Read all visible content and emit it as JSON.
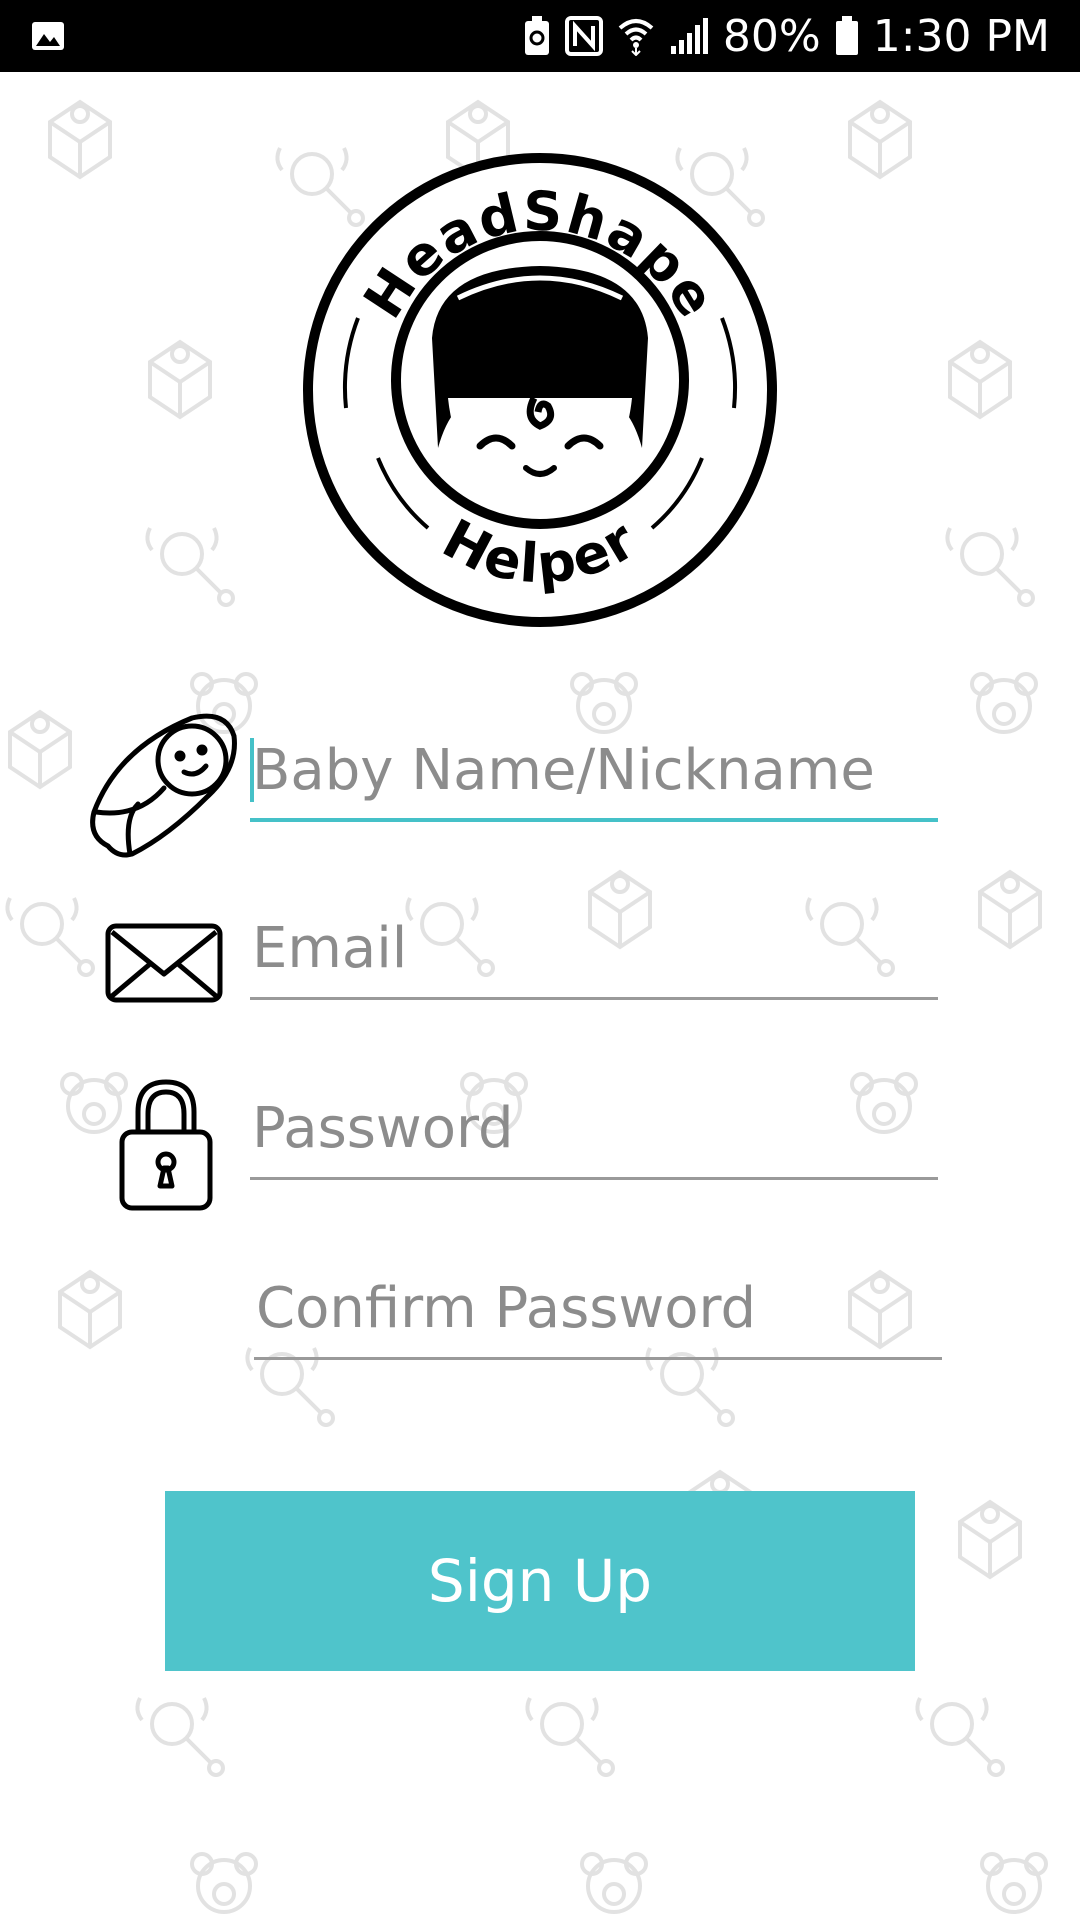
{
  "status_bar": {
    "battery_percent": "80%",
    "time": "1:30 PM",
    "icons": [
      "image-icon",
      "battery-saver-icon",
      "nfc-icon",
      "wifi-icon",
      "signal-icon",
      "battery-icon"
    ]
  },
  "logo": {
    "top_text": "HeadShape",
    "bottom_text": "Helper"
  },
  "form": {
    "baby_name": {
      "placeholder": "Baby Name/Nickname",
      "value": "",
      "icon": "baby-swaddle-icon"
    },
    "email": {
      "placeholder": "Email",
      "value": "",
      "icon": "envelope-icon"
    },
    "password": {
      "placeholder": "Password",
      "value": "",
      "icon": "lock-icon"
    },
    "confirm_password": {
      "placeholder": "Confirm Password",
      "value": ""
    },
    "submit_label": "Sign Up"
  },
  "colors": {
    "accent": "#4fc4cb",
    "status_bar": "#000000",
    "background": "#ffffff"
  }
}
